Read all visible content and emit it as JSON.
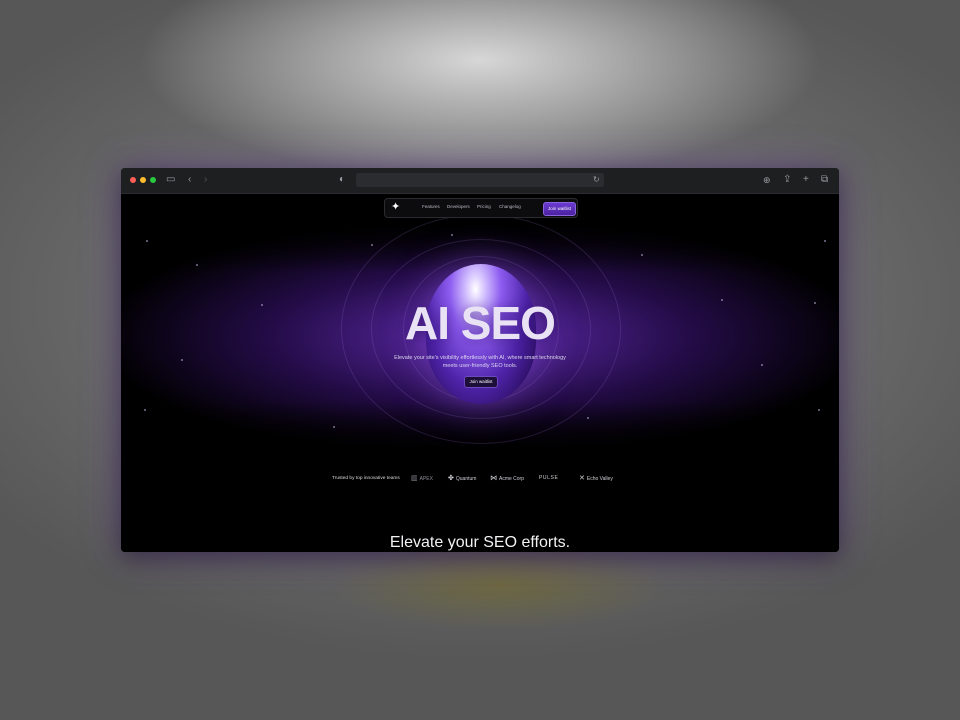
{
  "nav": {
    "logo_glyph": "✦",
    "links": [
      "Features",
      "Developers",
      "Pricing",
      "Changelog"
    ],
    "cta_label": "Join waitlist"
  },
  "hero": {
    "title": "AI SEO",
    "subtitle": "Elevate your site's visibility effortlessly with AI, where smart technology meets user-friendly SEO tools.",
    "cta_label": "Join waitlist"
  },
  "trusted": {
    "label": "Trusted by top innovative teams",
    "brands": [
      {
        "name": "APEX",
        "icon": "apex-logo-icon"
      },
      {
        "name": "Quantum",
        "icon": "quantum-logo-icon"
      },
      {
        "name": "Acme Corp",
        "icon": "acme-logo-icon"
      },
      {
        "name": "PULSE",
        "icon": "pulse-logo-icon"
      },
      {
        "name": "Echo Valley",
        "icon": "echo-valley-logo-icon"
      }
    ]
  },
  "section": {
    "title": "Elevate your SEO efforts."
  },
  "browser": {
    "icons": [
      "sidebar-icon",
      "back-icon",
      "forward-icon",
      "privacy-shield-icon",
      "reload-icon",
      "download-icon",
      "share-icon",
      "new-tab-icon",
      "tab-overview-icon"
    ]
  },
  "colors": {
    "accent": "#6a3ad0",
    "background": "#000000"
  }
}
